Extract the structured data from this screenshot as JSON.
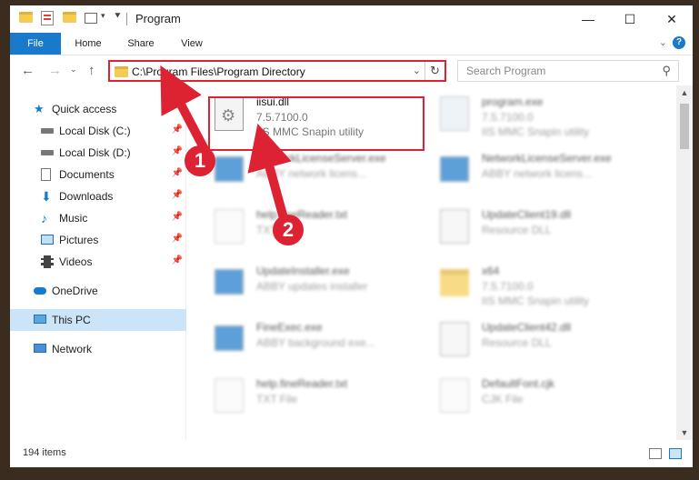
{
  "window": {
    "title": "Program",
    "controls": {
      "minimize": "—",
      "maximize": "☐",
      "close": "✕"
    }
  },
  "ribbon": {
    "tabs": [
      "File",
      "Home",
      "Share",
      "View"
    ],
    "help": "?"
  },
  "address": {
    "path": "C:\\Program Files\\Program Directory",
    "refresh": "↻"
  },
  "search": {
    "placeholder": "Search Program"
  },
  "sidebar": {
    "items": [
      {
        "label": "Quick access",
        "icon": "star-icon",
        "pinned": false
      },
      {
        "label": "Local Disk (C:)",
        "icon": "drive-icon",
        "pinned": true
      },
      {
        "label": "Local Disk (D:)",
        "icon": "drive-icon",
        "pinned": true
      },
      {
        "label": "Documents",
        "icon": "documents-icon",
        "pinned": true
      },
      {
        "label": "Downloads",
        "icon": "downloads-icon",
        "pinned": true
      },
      {
        "label": "Music",
        "icon": "music-icon",
        "pinned": true
      },
      {
        "label": "Pictures",
        "icon": "pictures-icon",
        "pinned": true
      },
      {
        "label": "Videos",
        "icon": "videos-icon",
        "pinned": true
      },
      {
        "label": "OneDrive",
        "icon": "cloud-icon",
        "pinned": false
      },
      {
        "label": "This PC",
        "icon": "computer-icon",
        "pinned": false,
        "selected": true
      },
      {
        "label": "Network",
        "icon": "network-icon",
        "pinned": false
      }
    ]
  },
  "files": [
    {
      "name": "iisui.dll",
      "line1": "7.5.7100.0",
      "line2": "IIS MMC Snapin utility",
      "icon": "dll-gear-icon",
      "highlighted": true
    },
    {
      "name": "program.exe",
      "line1": "7.5.7100.0",
      "line2": "IIS MMC Snapin utility",
      "icon": "exe-icon"
    },
    {
      "name": "NetworkLicenseServer.exe",
      "line1": "ABBY network licens...",
      "line2": "",
      "icon": "window-app-icon"
    },
    {
      "name": "NetworkLicenseServer.exe",
      "line1": "ABBY network licens...",
      "line2": "",
      "icon": "window-app-icon"
    },
    {
      "name": "help.fineReader.txt",
      "line1": "TXT File",
      "line2": "",
      "icon": "text-file-icon"
    },
    {
      "name": "UpdateClient19.dll",
      "line1": "Resource DLL",
      "line2": "",
      "icon": "dll-gear-icon"
    },
    {
      "name": "UpdateInstaller.exe",
      "line1": "ABBY updates installer",
      "line2": "",
      "icon": "window-app-icon"
    },
    {
      "name": "x64",
      "line1": "7.5.7100.0",
      "line2": "IIS MMC Snapin utility",
      "icon": "folder-icon"
    },
    {
      "name": "FineExec.exe",
      "line1": "ABBY background exe...",
      "line2": "",
      "icon": "window-app-icon"
    },
    {
      "name": "UpdateClient42.dll",
      "line1": "Resource DLL",
      "line2": "",
      "icon": "dll-gear-icon"
    },
    {
      "name": "help.fineReader.txt",
      "line1": "TXT File",
      "line2": "",
      "icon": "text-file-icon"
    },
    {
      "name": "DefaultFont.cjk",
      "line1": "CJK File",
      "line2": "",
      "icon": "text-file-icon"
    }
  ],
  "status": {
    "item_count": "194 items"
  },
  "annotations": {
    "step1": "1",
    "step2": "2"
  },
  "colors": {
    "accent": "#1979ca",
    "highlight": "#dd2233",
    "selected": "#cce4f7"
  }
}
